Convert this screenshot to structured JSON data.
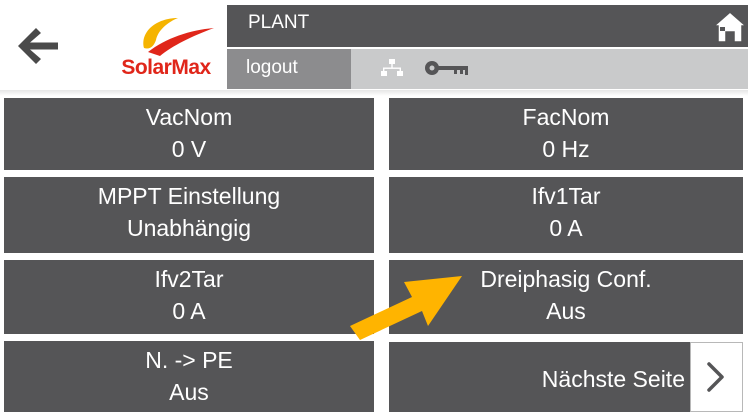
{
  "header": {
    "brand_name": "SolarMax",
    "title": "PLANT",
    "logout_label": "logout"
  },
  "tiles": [
    {
      "label": "VacNom",
      "value": "0 V"
    },
    {
      "label": "FacNom",
      "value": "0 Hz"
    },
    {
      "label": "MPPT Einstellung",
      "value": "Unabhängig"
    },
    {
      "label": "Ifv1Tar",
      "value": "0 A"
    },
    {
      "label": "Ifv2Tar",
      "value": "0 A"
    },
    {
      "label": "Dreiphasig Conf.",
      "value": "Aus"
    },
    {
      "label": "N. -> PE",
      "value": "Aus"
    }
  ],
  "next_page": {
    "label": "Nächste Seite"
  },
  "colors": {
    "tile_bg": "#555557",
    "brand_red": "#e0261a",
    "brand_yellow": "#f5b400",
    "annotation_arrow": "#ffb400"
  },
  "icons": [
    "back-arrow-icon",
    "solarmax-logo",
    "home-icon",
    "network-icon",
    "key-icon",
    "chevron-right-icon"
  ]
}
